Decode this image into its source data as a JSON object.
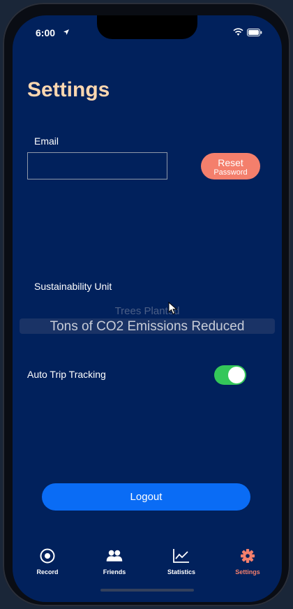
{
  "status_bar": {
    "time": "6:00"
  },
  "page": {
    "title": "Settings"
  },
  "email": {
    "label": "Email",
    "value": ""
  },
  "reset_button": {
    "line1": "Reset",
    "line2": "Password"
  },
  "sustainability": {
    "label": "Sustainability Unit",
    "options_visible": [
      "Trees Planted",
      "Tons of CO2 Emissions Reduced"
    ],
    "selected": "Tons of CO2 Emissions Reduced"
  },
  "auto_tracking": {
    "label": "Auto Trip Tracking",
    "enabled": true
  },
  "logout_label": "Logout",
  "tabs": [
    {
      "label": "Record",
      "icon": "record-icon"
    },
    {
      "label": "Friends",
      "icon": "friends-icon"
    },
    {
      "label": "Statistics",
      "icon": "statistics-icon"
    },
    {
      "label": "Settings",
      "icon": "gear-icon",
      "active": true
    }
  ],
  "colors": {
    "background": "#01215c",
    "title": "#fdd7b0",
    "accent": "#f47f6c",
    "logout": "#0a6cf5",
    "toggle_on": "#34c759"
  }
}
